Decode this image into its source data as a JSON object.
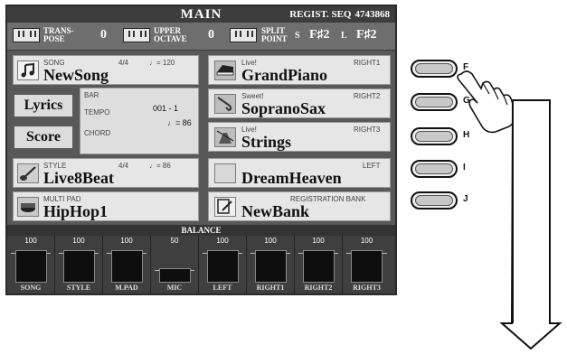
{
  "header": {
    "title": "MAIN",
    "regist_label": "REGIST. SEQ",
    "regist_value": "4743868"
  },
  "info": {
    "transpose_label1": "TRANS-",
    "transpose_label2": "POSE",
    "transpose_value": "0",
    "upper_label1": "UPPER",
    "upper_label2": "OCTAVE",
    "upper_value": "0",
    "split_label1": "SPLIT",
    "split_label2": "POINT",
    "split_s_key": "S",
    "split_s_val": "F♯2",
    "split_l_key": "L",
    "split_l_val": "F♯2"
  },
  "song": {
    "label": "SONG",
    "time_sig": "4/4",
    "tempo": "♩= 120",
    "name": "NewSong"
  },
  "buttons": {
    "lyrics": "Lyrics",
    "score": "Score"
  },
  "song_info": {
    "bar_label": "BAR",
    "bar_value": "001 -   1",
    "tempo_label": "TEMPO",
    "tempo_value": "♩= 86",
    "chord_label": "CHORD"
  },
  "style": {
    "label": "STYLE",
    "time_sig": "4/4",
    "tempo": "♩= 86",
    "name": "Live8Beat"
  },
  "multipad": {
    "label": "MULTI PAD",
    "name": "HipHop1"
  },
  "voices": [
    {
      "tag": "Live!",
      "part": "RIGHT1",
      "name": "GrandPiano"
    },
    {
      "tag": "Sweet!",
      "part": "RIGHT2",
      "name": "SopranoSax"
    },
    {
      "tag": "Live!",
      "part": "RIGHT3",
      "name": "Strings"
    },
    {
      "tag": "",
      "part": "LEFT",
      "name": "DreamHeaven"
    }
  ],
  "registration": {
    "label": "REGISTRATION BANK",
    "name": "NewBank"
  },
  "balance": {
    "title": "BALANCE",
    "channels": [
      {
        "label": "SONG",
        "value": "100"
      },
      {
        "label": "STYLE",
        "value": "100"
      },
      {
        "label": "M.PAD",
        "value": "100"
      },
      {
        "label": "MIC",
        "value": "50"
      },
      {
        "label": "LEFT",
        "value": "100"
      },
      {
        "label": "RIGHT1",
        "value": "100"
      },
      {
        "label": "RIGHT2",
        "value": "100"
      },
      {
        "label": "RIGHT3",
        "value": "100"
      }
    ]
  },
  "hardware_buttons": [
    "F",
    "G",
    "H",
    "I",
    "J"
  ]
}
